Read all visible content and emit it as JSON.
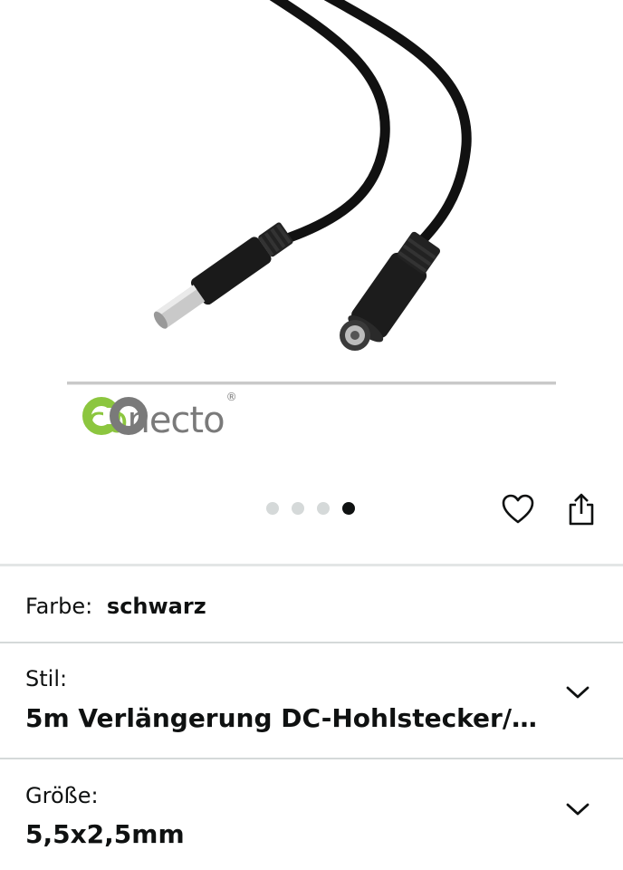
{
  "product_image": {
    "brand_prefix": "co",
    "brand_suffix": "necto",
    "brand_registered": "®",
    "carousel": {
      "total": 4,
      "active_index": 3
    }
  },
  "actions": {
    "favorite_icon": "heart-icon",
    "share_icon": "share-icon"
  },
  "variants": {
    "color": {
      "label": "Farbe:",
      "value": "schwarz"
    },
    "style": {
      "label": "Stil:",
      "value": "5m Verlängerung DC-Hohlstecker/…"
    },
    "size": {
      "label": "Größe:",
      "value": "5,5x2,5mm"
    }
  },
  "colors": {
    "brand_green": "#8cc63f",
    "brand_gray": "#7a7a7a",
    "text": "#0f1111",
    "divider": "#d5d9d9"
  }
}
